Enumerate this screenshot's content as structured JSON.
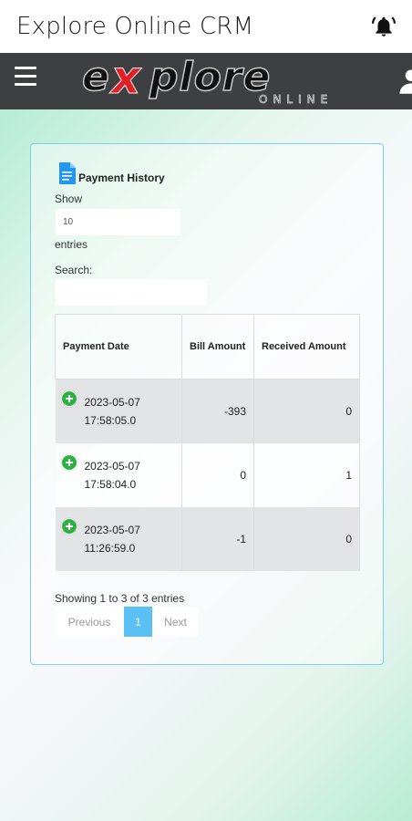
{
  "app": {
    "title": "Explore Online CRM"
  },
  "header": {
    "logo_main": "explore",
    "logo_sub": "ONLINE"
  },
  "card": {
    "title": "Payment History",
    "show_label": "Show",
    "entries_value": "10",
    "entries_label": "entries",
    "search_label": "Search:",
    "search_value": ""
  },
  "table": {
    "headers": [
      "Payment Date",
      "Bill Amount",
      "Received Amount"
    ],
    "rows": [
      {
        "date": "2023-05-07",
        "time": "17:58:05.0",
        "bill": "-393",
        "received": "0"
      },
      {
        "date": "2023-05-07",
        "time": "17:58:04.0",
        "bill": "0",
        "received": "1"
      },
      {
        "date": "2023-05-07",
        "time": "11:26:59.0",
        "bill": "-1",
        "received": "0"
      }
    ]
  },
  "footer": {
    "info": "Showing 1 to 3 of 3 entries",
    "prev": "Previous",
    "page": "1",
    "next": "Next"
  },
  "colors": {
    "accent": "#5bc0f4",
    "navbar": "#3d3f40",
    "expand_icon": "#2db142",
    "logo_red": "#e21f26"
  },
  "icons": [
    "bell-icon",
    "menu-icon",
    "user-icon",
    "document-icon",
    "expand-row-icon"
  ]
}
